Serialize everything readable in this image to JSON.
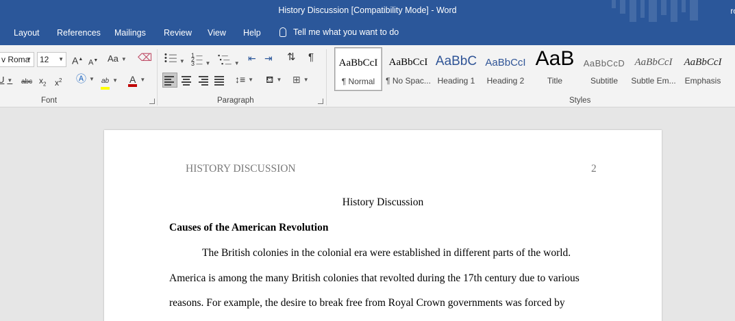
{
  "titlebar": {
    "title": "History Discussion [Compatibility Mode]  -  Word",
    "user": "ro"
  },
  "tabs": [
    "Layout",
    "References",
    "Mailings",
    "Review",
    "View",
    "Help"
  ],
  "tell_me": "Tell me what you want to do",
  "ribbon": {
    "font": {
      "group_label": "Font",
      "font_name": "v Roma",
      "font_size": "12",
      "grow_icon": "A",
      "shrink_icon": "A",
      "case_label": "Aa",
      "strike_label": "abc",
      "sub_label": "x",
      "sub_mark": "2",
      "sup_label": "x",
      "sup_mark": "2",
      "highlight_label": "ab",
      "font_color_label": "A",
      "highlight_color": "#ffff00",
      "font_color": "#c00000"
    },
    "paragraph": {
      "group_label": "Paragraph"
    },
    "styles": {
      "group_label": "Styles",
      "items": [
        {
          "preview": "AaBbCcI",
          "name": "¶ Normal"
        },
        {
          "preview": "AaBbCcI",
          "name": "¶ No Spac..."
        },
        {
          "preview": "AaBbC",
          "name": "Heading 1"
        },
        {
          "preview": "AaBbCcI",
          "name": "Heading 2"
        },
        {
          "preview": "AaB",
          "name": "Title"
        },
        {
          "preview": "AaBbCcD",
          "name": "Subtitle"
        },
        {
          "preview": "AaBbCcI",
          "name": "Subtle Em..."
        },
        {
          "preview": "AaBbCcI",
          "name": "Emphasis"
        }
      ]
    }
  },
  "document": {
    "header_text": "HISTORY DISCUSSION",
    "page_number": "2",
    "title": "History Discussion",
    "heading": "Causes of the American Revolution",
    "lines": [
      "The British colonies in the colonial era were established in different parts of the world.",
      "America is among the many British colonies that revolted during the 17th century due to various",
      "reasons. For example, the desire to break free from Royal Crown governments was forced by"
    ]
  }
}
